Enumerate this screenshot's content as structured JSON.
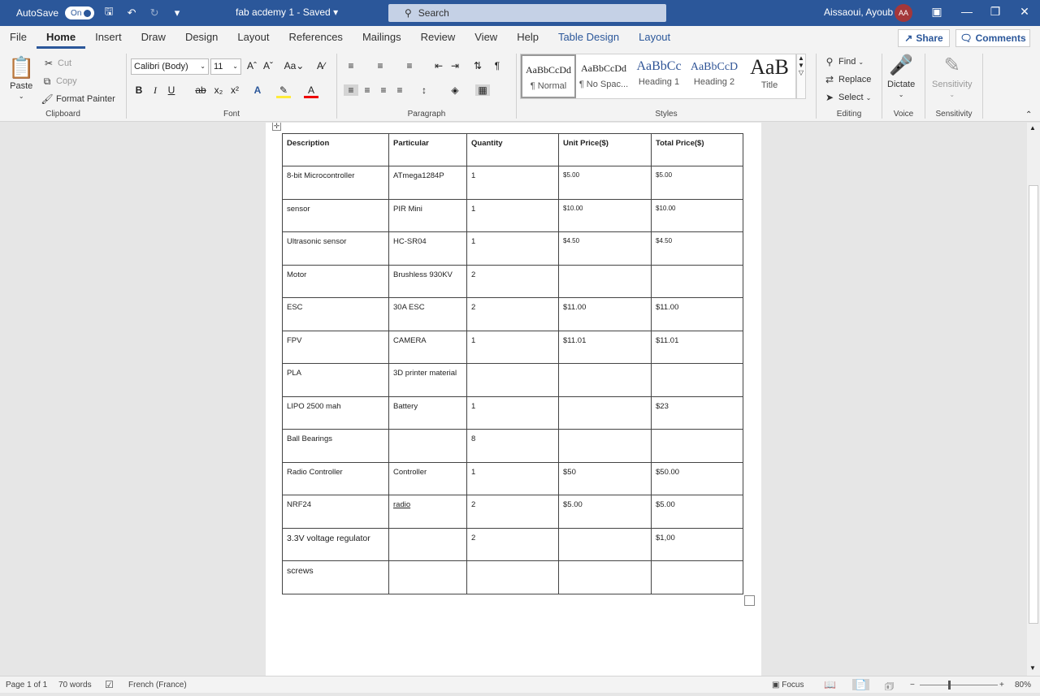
{
  "titlebar": {
    "autosave_label": "AutoSave",
    "autosave_state": "On",
    "doc_title": "fab acdemy 1  -  Saved",
    "search_placeholder": "Search",
    "user_name": "Aissaoui, Ayoub",
    "user_initials": "AA"
  },
  "menu": {
    "tabs": [
      "File",
      "Home",
      "Insert",
      "Draw",
      "Design",
      "Layout",
      "References",
      "Mailings",
      "Review",
      "View",
      "Help",
      "Table Design",
      "Layout"
    ],
    "active": "Home",
    "share": "Share",
    "comments": "Comments"
  },
  "ribbon": {
    "clipboard": {
      "paste": "Paste",
      "cut": "Cut",
      "copy": "Copy",
      "format_painter": "Format Painter",
      "label": "Clipboard"
    },
    "font": {
      "name": "Calibri (Body)",
      "size": "11",
      "label": "Font"
    },
    "paragraph": {
      "label": "Paragraph"
    },
    "styles": {
      "items": [
        {
          "sample": "AaBbCcDd",
          "name": "¶ Normal"
        },
        {
          "sample": "AaBbCcDd",
          "name": "¶ No Spac..."
        },
        {
          "sample": "AaBbCc",
          "name": "Heading 1"
        },
        {
          "sample": "AaBbCcD",
          "name": "Heading 2"
        },
        {
          "sample": "AaB",
          "name": "Title"
        }
      ],
      "label": "Styles"
    },
    "editing": {
      "find": "Find",
      "replace": "Replace",
      "select": "Select",
      "label": "Editing"
    },
    "voice": {
      "dictate": "Dictate",
      "label": "Voice"
    },
    "sensitivity": {
      "button": "Sensitivity",
      "label": "Sensitivity"
    }
  },
  "table": {
    "headers": [
      "Description",
      "Particular",
      "Quantity",
      "Unit Price($)",
      "Total Price($)"
    ],
    "rows": [
      [
        "8-bit Microcontroller",
        "ATmega1284P",
        "1",
        "$5.00",
        "$5.00"
      ],
      [
        "sensor",
        "PIR Mini",
        "1",
        "$10.00",
        "$10.00"
      ],
      [
        "Ultrasonic sensor",
        "HC-SR04",
        "1",
        "$4.50",
        "$4.50"
      ],
      [
        "Motor",
        "Brushless 930KV",
        "2",
        "",
        ""
      ],
      [
        "ESC",
        "30A ESC",
        "2",
        "$11.00",
        "$11.00"
      ],
      [
        "FPV",
        "CAMERA",
        "1",
        "$11.01",
        "$11.01"
      ],
      [
        "PLA",
        "3D printer material",
        "",
        "",
        ""
      ],
      [
        "LIPO 2500 mah",
        "Battery",
        "1",
        "",
        "$23"
      ],
      [
        "Ball Bearings",
        "",
        "8",
        "",
        ""
      ],
      [
        "Radio Controller",
        "Controller",
        "1",
        "$50",
        "$50.00"
      ],
      [
        "NRF24",
        "radio",
        "2",
        "$5.00",
        "$5.00"
      ],
      [
        "3.3V voltage regulator",
        "",
        "2",
        "",
        "$1,00"
      ],
      [
        "screws",
        "",
        "",
        "",
        ""
      ]
    ]
  },
  "status": {
    "page": "Page 1 of 1",
    "words": "70 words",
    "language": "French (France)",
    "focus": "Focus",
    "zoom": "80%"
  }
}
